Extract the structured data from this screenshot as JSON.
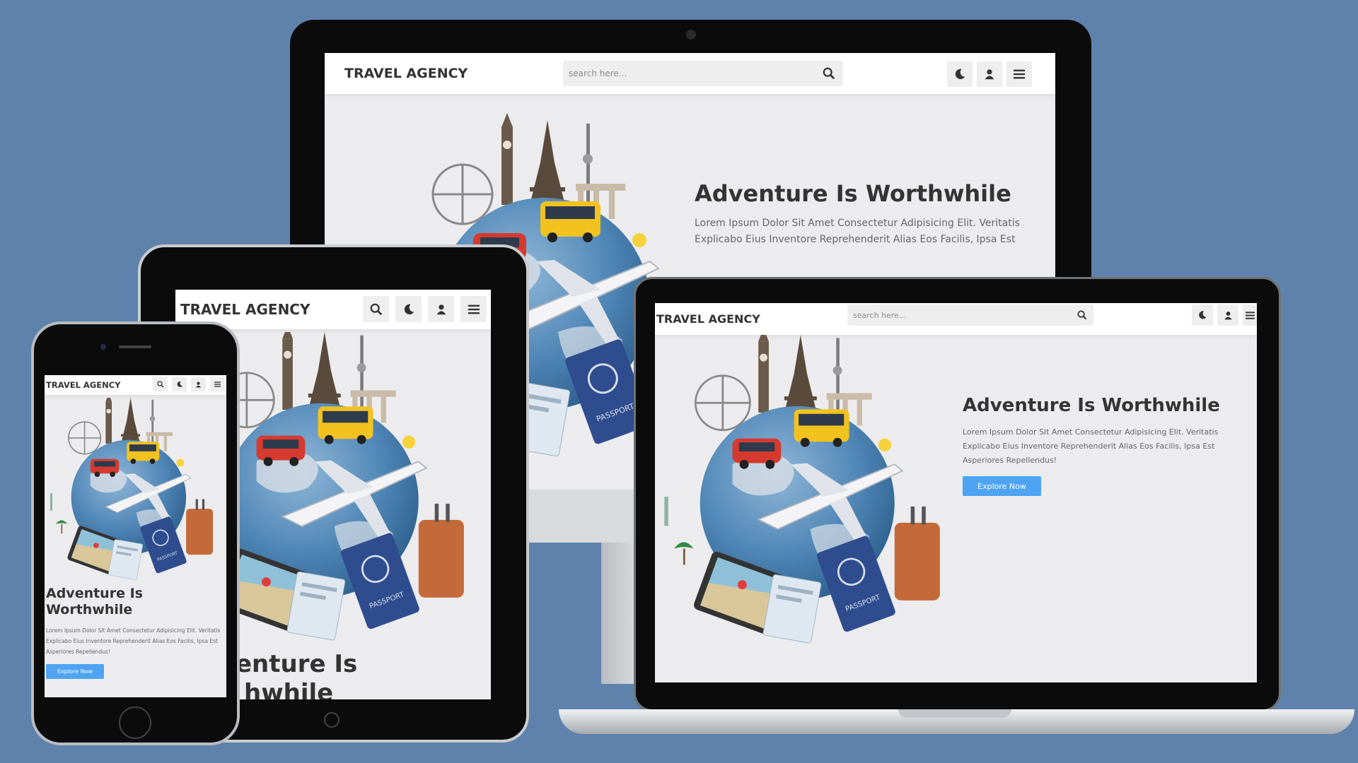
{
  "colors": {
    "background": "#5f82ad",
    "accent": "#4ea4f2",
    "text_dark": "#333333",
    "device_black": "#0b0b0b"
  },
  "site": {
    "logo": "TRAVEL AGENCY",
    "search_placeholder": "search here...",
    "icons": [
      "search-icon",
      "moon-icon",
      "user-icon",
      "menu-icon"
    ],
    "hero": {
      "title": "Adventure Is Worthwhile",
      "title_mobile_line1": "Adventure Is",
      "title_mobile_line2": "Worthwhile",
      "tablet_title_line1": "enture Is",
      "tablet_title_line2": "hwhile",
      "desktop_text": "Lorem Ipsum Dolor Sit Amet Consectetur Adipisicing Elit. Veritatis Explicabo Eius Inventore Reprehenderit Alias Eos Facilis, Ipsa Est",
      "text": "Lorem Ipsum Dolor Sit Amet Consectetur Adipisicing Elit. Veritatis Explicabo Eius Inventore Reprehenderit Alias Eos Facilis, Ipsa Est Asperiores Repellendus!",
      "button": "Explore Now"
    }
  },
  "illustration": {
    "elements": [
      "globe",
      "eiffel-tower",
      "big-ben",
      "london-eye",
      "tv-tower",
      "brandenburg-gate",
      "airplane",
      "yellow-bus",
      "red-car",
      "suitcase",
      "passport",
      "tablet-map",
      "tickets",
      "sun",
      "palm-tree",
      "statue-of-liberty"
    ],
    "passport_label": "PASSPORT"
  }
}
